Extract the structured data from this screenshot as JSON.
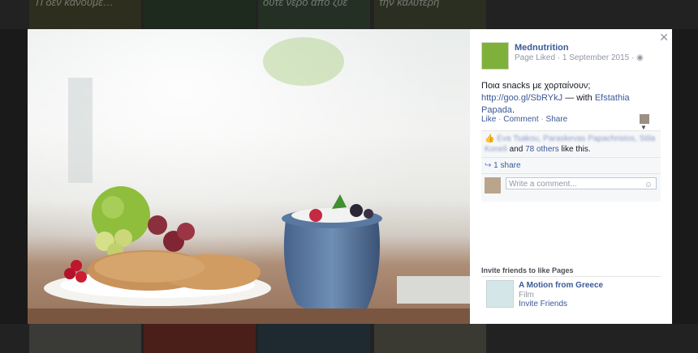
{
  "background": {
    "tiles": [
      "Ti δεν κάνουμε…",
      "",
      "ούτε νερό από ζυε",
      "την καλύτερη"
    ]
  },
  "post": {
    "page_name": "Mednutrition",
    "meta": "Page Liked · 1 September 2015 ·",
    "text": "Ποια snacks με χορταίνουν;",
    "link": "http://goo.gl/SbRYkJ",
    "with_prefix": " — with ",
    "tagged": "Efstathia Papada",
    "tagged_suffix": "."
  },
  "actions": {
    "like": "Like",
    "comment": "Comment",
    "share": "Share"
  },
  "ufi": {
    "likers_blurred": "Eva Tsakou, Paraskevas Papachristos, Stila Koneli",
    "likers_and": "and",
    "others_count": "78 others",
    "likers_suffix": "like this.",
    "shares": "1 share",
    "comment_placeholder": "Write a comment..."
  },
  "invite": {
    "title": "Invite friends to like Pages",
    "page_name": "A Motion from Greece",
    "category": "Film",
    "button": "Invite Friends"
  },
  "icons": {
    "close": "close-icon",
    "globe": "globe-icon",
    "thumbs_up": "thumbs-up-icon",
    "share_arrow": "share-icon",
    "smiley": "emoji-icon"
  },
  "colors": {
    "fb_blue": "#3b5998",
    "meta_gray": "#9197a3"
  }
}
